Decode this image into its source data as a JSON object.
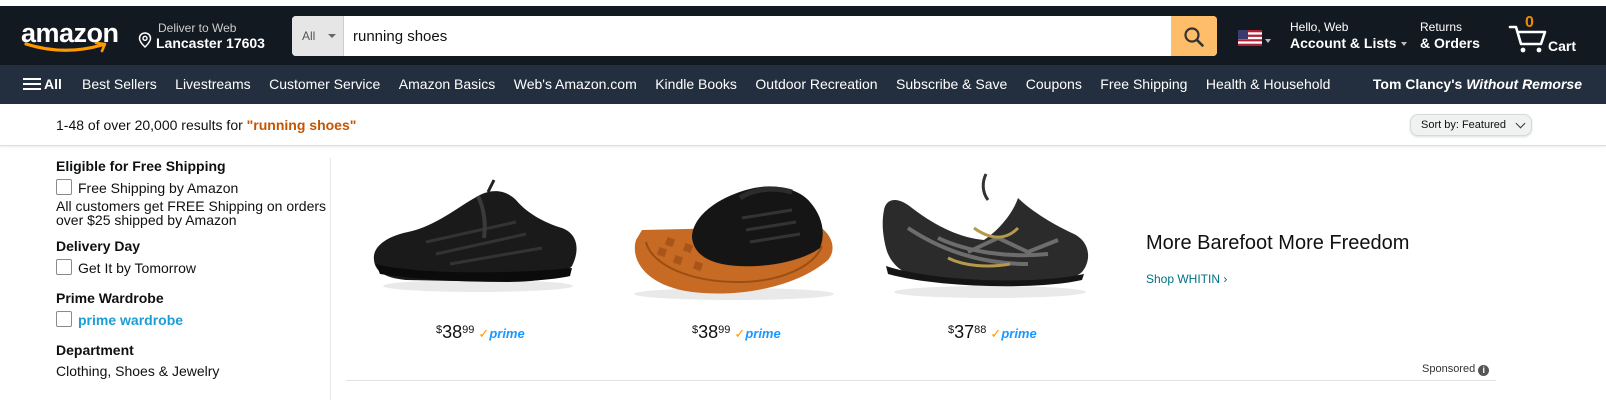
{
  "header": {
    "logo_text": "amazon",
    "deliver_line1": "Deliver to Web",
    "deliver_line2": "Lancaster 17603",
    "search_category": "All",
    "search_value": "running shoes",
    "account_line1": "Hello, Web",
    "account_line2": "Account & Lists",
    "returns_line1": "Returns",
    "returns_line2": "& Orders",
    "cart_count": "0",
    "cart_label": "Cart"
  },
  "nav": {
    "all_label": "All",
    "items": [
      "Best Sellers",
      "Livestreams",
      "Customer Service",
      "Amazon Basics",
      "Web's Amazon.com",
      "Kindle Books",
      "Outdoor Recreation",
      "Subscribe & Save",
      "Coupons",
      "Free Shipping",
      "Health & Household"
    ],
    "promo_prefix": "Tom Clancy's ",
    "promo_italic": "Without Remorse"
  },
  "results": {
    "count_text": "1-48 of over 20,000 results for ",
    "query_text": "\"running shoes\"",
    "sort_label": "Sort by:  Featured"
  },
  "sidebar": {
    "free_shipping_title": "Eligible for Free Shipping",
    "free_shipping_option": "Free Shipping by Amazon",
    "free_shipping_note": "All customers get FREE Shipping on orders over $25 shipped by Amazon",
    "delivery_title": "Delivery Day",
    "delivery_option": "Get It by Tomorrow",
    "prime_title": "Prime Wardrobe",
    "prime_option": "prime wardrobe",
    "department_title": "Department",
    "department_item": "Clothing, Shoes & Jewelry"
  },
  "banner": {
    "headline": "More Barefoot More Freedom",
    "shop_link": "Shop WHITIN ›",
    "sponsored": "Sponsored",
    "products": [
      {
        "currency": "$",
        "whole": "38",
        "fraction": "99",
        "prime_label": "prime"
      },
      {
        "currency": "$",
        "whole": "38",
        "fraction": "99",
        "prime_label": "prime"
      },
      {
        "currency": "$",
        "whole": "37",
        "fraction": "88",
        "prime_label": "prime"
      }
    ]
  },
  "colors": {
    "nav_top_bg": "#131921",
    "nav_main_bg": "#232f3e",
    "search_button": "#febd69",
    "query_highlight": "#c45500",
    "prime_blue": "#1a98ff",
    "link_teal": "#007185"
  }
}
